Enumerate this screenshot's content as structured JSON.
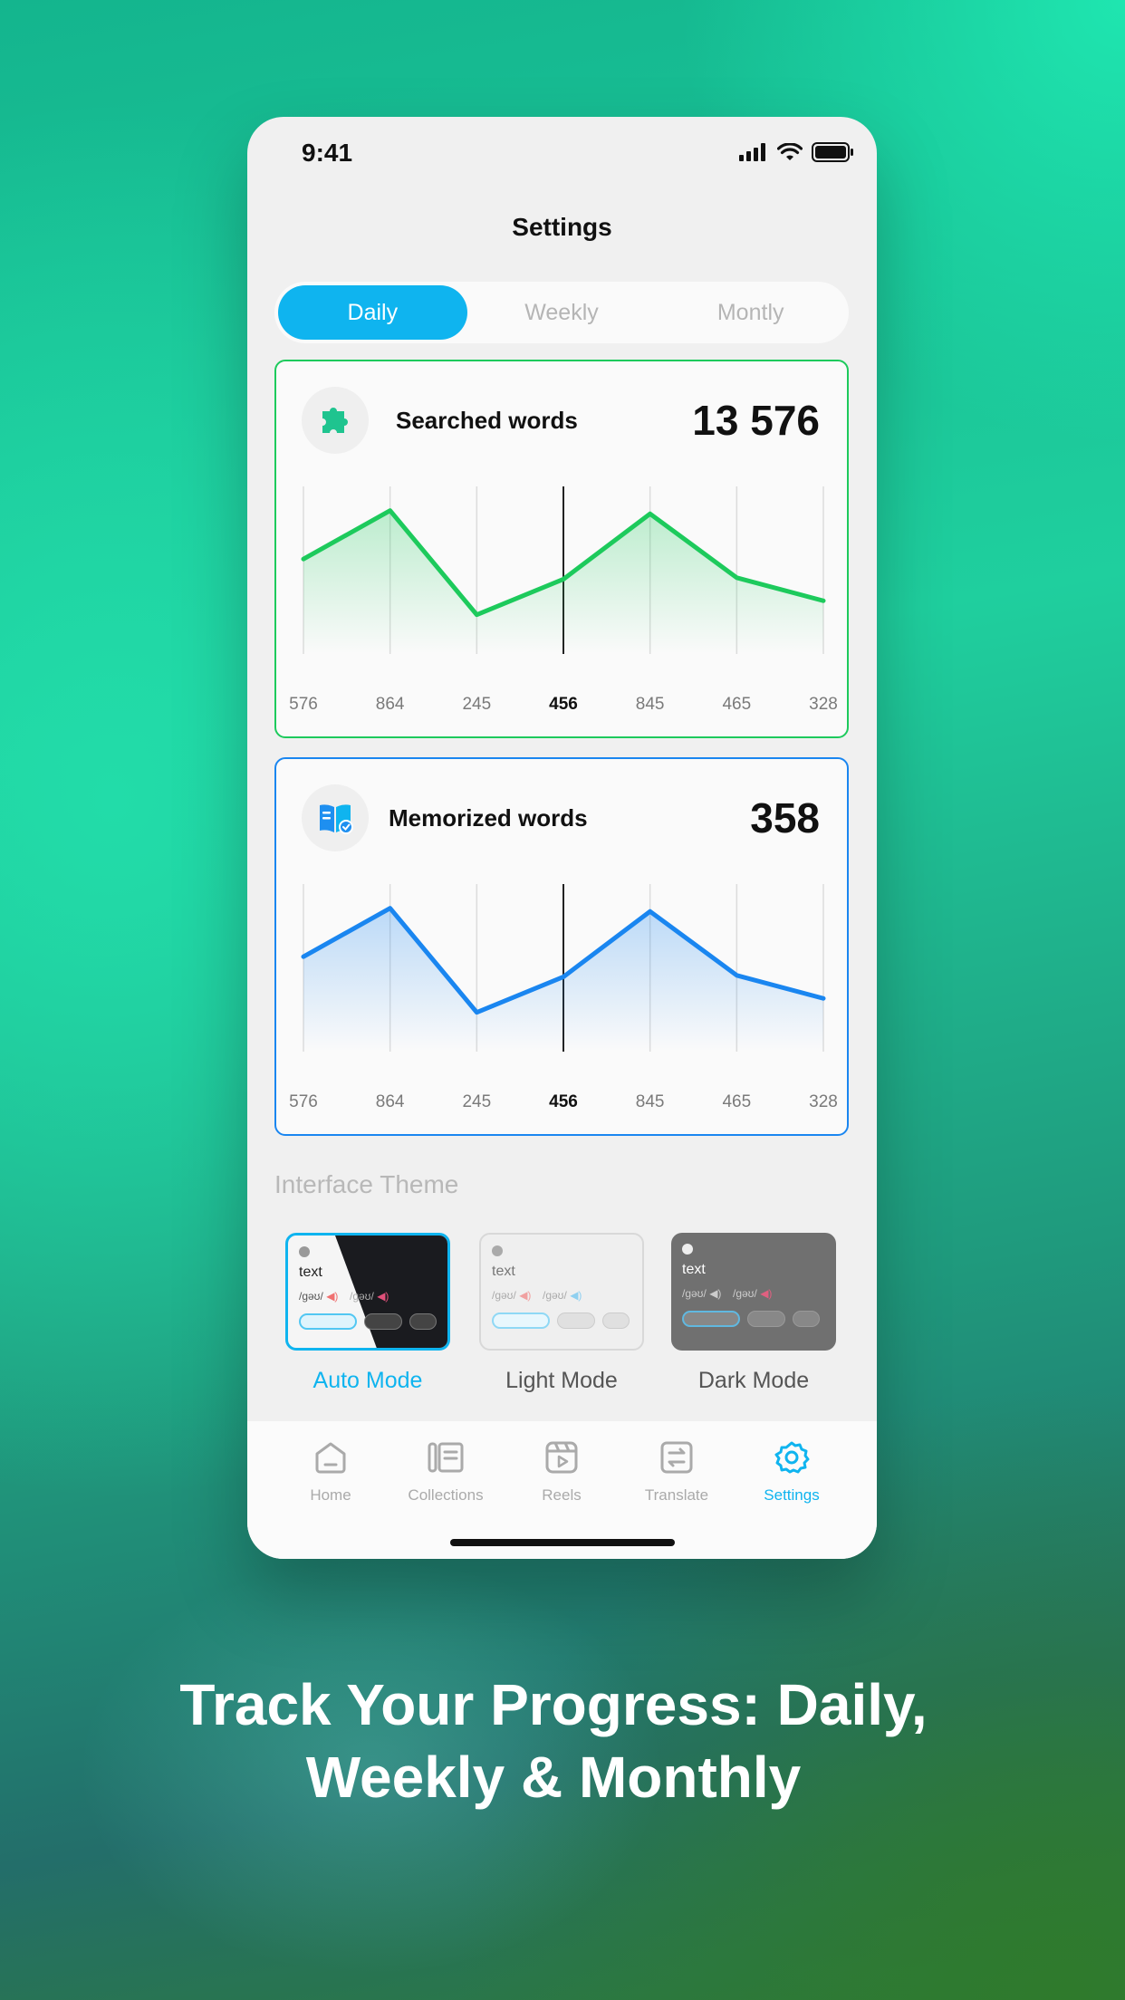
{
  "status_bar": {
    "time": "9:41"
  },
  "header": {
    "title": "Settings"
  },
  "period_tabs": [
    {
      "label": "Daily",
      "active": true
    },
    {
      "label": "Weekly",
      "active": false
    },
    {
      "label": "Montly",
      "active": false
    }
  ],
  "cards": [
    {
      "label": "Searched words",
      "value": "13 576",
      "icon": "puzzle-icon",
      "accent": "#1dca5c"
    },
    {
      "label": "Memorized words",
      "value": "358",
      "icon": "book-check-icon",
      "accent": "#1a86f0"
    }
  ],
  "chart_data": [
    {
      "type": "area",
      "categories": [
        "576",
        "864",
        "245",
        "456",
        "845",
        "465",
        "328"
      ],
      "values": [
        576,
        864,
        245,
        456,
        845,
        465,
        328
      ],
      "highlighted_index": 3,
      "color": "#1dca5c"
    },
    {
      "type": "area",
      "categories": [
        "576",
        "864",
        "245",
        "456",
        "845",
        "465",
        "328"
      ],
      "values": [
        576,
        864,
        245,
        456,
        845,
        465,
        328
      ],
      "highlighted_index": 3,
      "color": "#1a86f0"
    }
  ],
  "theme_section": {
    "title": "Interface Theme",
    "preview_text": "text",
    "preview_phonetic": "/gəʊ/",
    "options": [
      {
        "label": "Auto Mode",
        "active": true
      },
      {
        "label": "Light Mode",
        "active": false
      },
      {
        "label": "Dark Mode",
        "active": false
      }
    ]
  },
  "tab_bar": [
    {
      "label": "Home",
      "icon": "home-icon",
      "active": false
    },
    {
      "label": "Collections",
      "icon": "collections-icon",
      "active": false
    },
    {
      "label": "Reels",
      "icon": "reels-icon",
      "active": false
    },
    {
      "label": "Translate",
      "icon": "translate-icon",
      "active": false
    },
    {
      "label": "Settings",
      "icon": "gear-icon",
      "active": true
    }
  ],
  "headline": {
    "line1": "Track Your Progress: Daily,",
    "line2": "Weekly & Monthly"
  },
  "colors": {
    "accent": "#0fb4ef",
    "green": "#1dca5c",
    "blue": "#1a86f0"
  }
}
